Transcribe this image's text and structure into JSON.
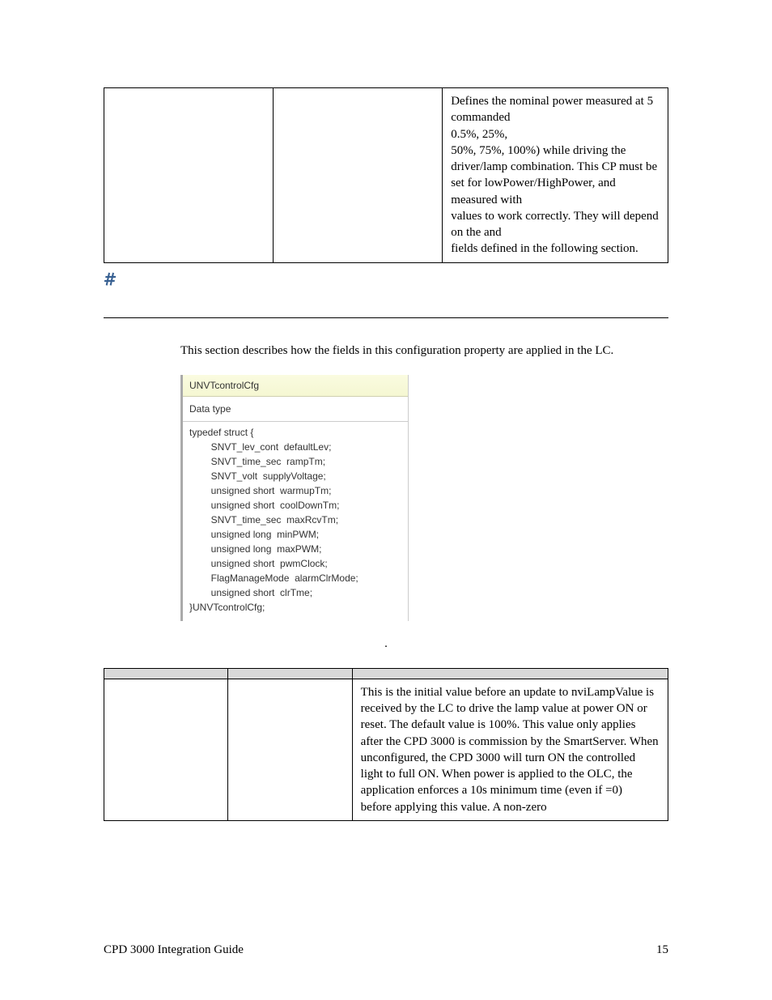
{
  "tableA": {
    "row1": {
      "c1": "",
      "c2": "",
      "c3_line1": "Defines the nominal power measured at 5 commanded",
      "c3_pad1": "",
      "c3_line1b": " 0.5%, 25%,",
      "c3_line2": "50%, 75%, 100%) while driving the driver/lamp combination. This CP must be set for lowPower/HighPower, and measured with",
      "c3_line3a": "values to work correctly.  They will depend on the ",
      "c3_line3b": " and ",
      "c3_line3c": " fields defined in the following section."
    }
  },
  "hash": "#",
  "intro": "This section describes how the fields in this configuration property are applied in the LC.",
  "struct": {
    "title": "UNVTcontrolCfg",
    "datatype": "Data type",
    "code": "typedef struct {\n        SNVT_lev_cont  defaultLev;\n        SNVT_time_sec  rampTm;\n        SNVT_volt  supplyVoltage;\n        unsigned short  warmupTm;\n        unsigned short  coolDownTm;\n        SNVT_time_sec  maxRcvTm;\n        unsigned long  minPWM;\n        unsigned long  maxPWM;\n        unsigned short  pwmClock;\n        FlagManageMode  alarmClrMode;\n        unsigned short  clrTme;\n}UNVTcontrolCfg;"
  },
  "caption_dot": ".",
  "tableB": {
    "h1": "",
    "h2": "",
    "h3": "",
    "row1": {
      "c1": "",
      "c2": "",
      "c3_a": "This is the initial value before an update to nviLampValue is received by the LC to drive the lamp value at power ON or reset. The default value is 100%.  This value only applies after the CPD 3000 is commission by the SmartServer.  When unconfigured, the CPD 3000 will turn ON the controlled light to full ON.  When power is applied to the OLC, the application enforces a 10s minimum time (even if ",
      "c3_b": " =0)",
      "c3_c": "before applying this value.  A non-zero"
    }
  },
  "footer": {
    "left": "CPD 3000 Integration Guide",
    "right": "15"
  }
}
